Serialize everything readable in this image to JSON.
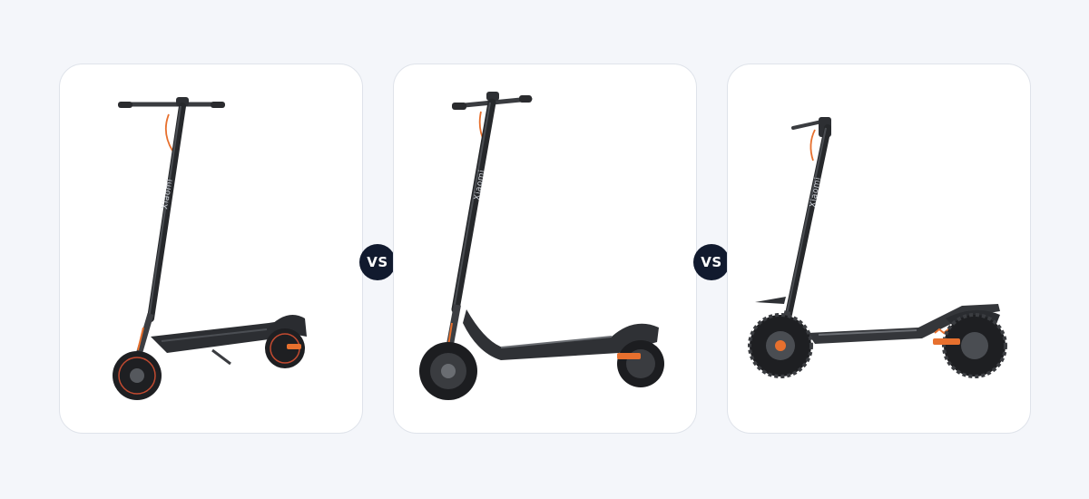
{
  "comparison": {
    "separator_label": "VS",
    "products": [
      {
        "brand_label": "Xiaomi",
        "image": "scooter-photo",
        "accent_color": "#e7702e"
      },
      {
        "brand_label": "Xiaomi",
        "image": "scooter-photo",
        "accent_color": "#e7702e"
      },
      {
        "brand_label": "Xiaomi",
        "image": "scooter-photo",
        "accent_color": "#e7702e"
      }
    ]
  },
  "colors": {
    "page_background": "#f4f6fa",
    "card_background": "#ffffff",
    "card_border": "#dfe3ea",
    "badge_background": "#111a2e",
    "badge_text": "#ffffff"
  }
}
